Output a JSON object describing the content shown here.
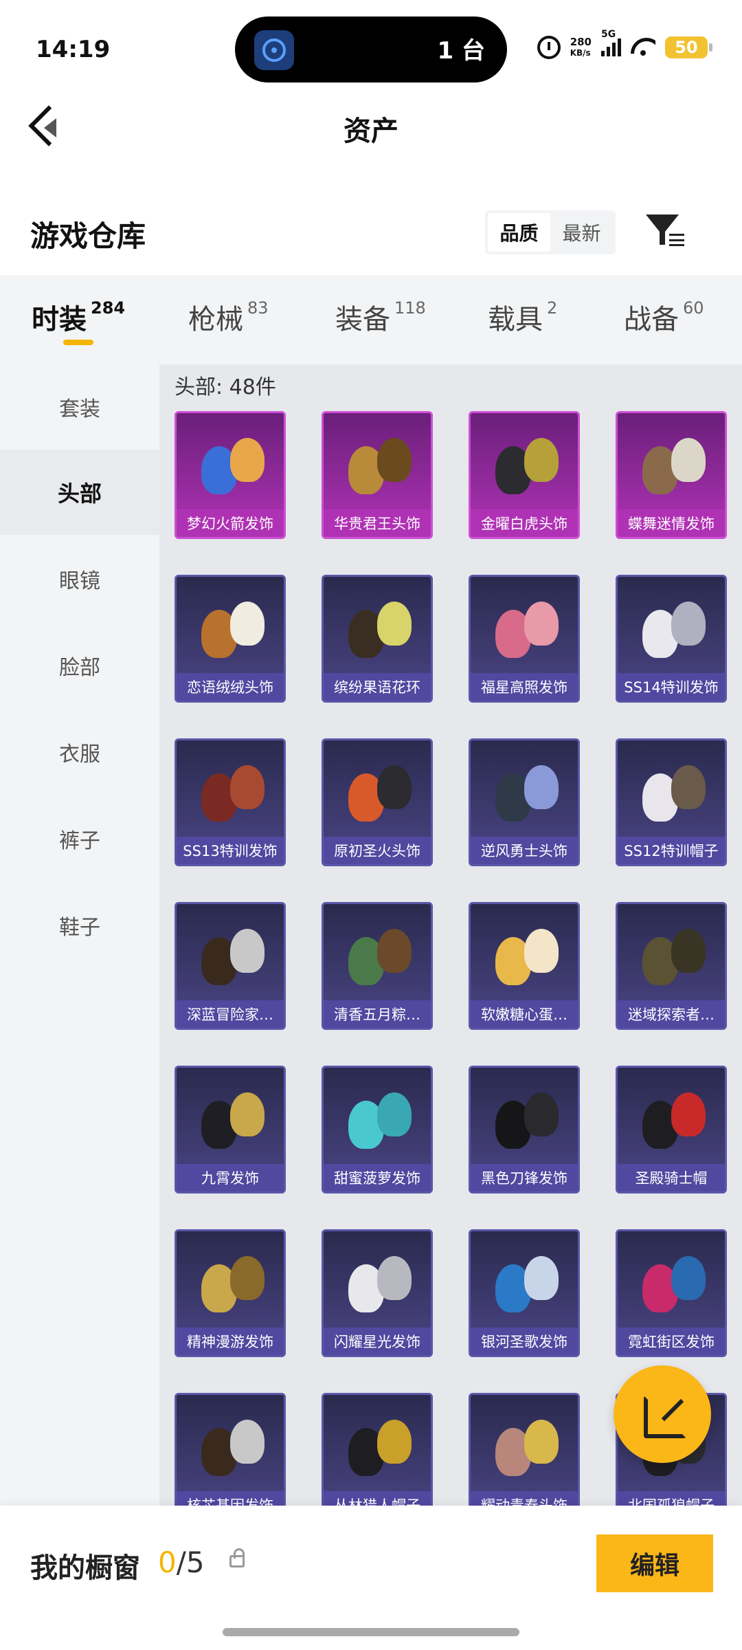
{
  "status_bar": {
    "time": "14:19",
    "island_text": "1 台",
    "island_badge": "1",
    "net_speed_value": "280",
    "net_speed_unit": "KB/s",
    "network": "5G",
    "battery": "50"
  },
  "header": {
    "title": "资产"
  },
  "section": {
    "title": "游戏仓库",
    "sort_options": [
      "品质",
      "最新"
    ],
    "sort_selected": "品质"
  },
  "tabs": [
    {
      "label": "时装",
      "count": "284",
      "active": true
    },
    {
      "label": "枪械",
      "count": "83",
      "active": false
    },
    {
      "label": "装备",
      "count": "118",
      "active": false
    },
    {
      "label": "载具",
      "count": "2",
      "active": false
    },
    {
      "label": "战备",
      "count": "60",
      "active": false
    }
  ],
  "side_nav": [
    {
      "label": "套装",
      "active": false
    },
    {
      "label": "头部",
      "active": true
    },
    {
      "label": "眼镜",
      "active": false
    },
    {
      "label": "脸部",
      "active": false
    },
    {
      "label": "衣服",
      "active": false
    },
    {
      "label": "裤子",
      "active": false
    },
    {
      "label": "鞋子",
      "active": false
    }
  ],
  "grid": {
    "header": "头部: 48件",
    "items": [
      {
        "name": "梦幻火箭发饰",
        "rarity": "purple",
        "colors": [
          "#3a6fd8",
          "#e8a84a"
        ]
      },
      {
        "name": "华贵君王头饰",
        "rarity": "purple",
        "colors": [
          "#b88a3a",
          "#6b4a1f"
        ]
      },
      {
        "name": "金曜白虎头饰",
        "rarity": "purple",
        "colors": [
          "#2b2b30",
          "#b5a03a"
        ]
      },
      {
        "name": "蝶舞迷情发饰",
        "rarity": "purple",
        "colors": [
          "#8a6a4a",
          "#dcd6c8"
        ]
      },
      {
        "name": "恋语绒绒头饰",
        "rarity": "blue",
        "colors": [
          "#b8722e",
          "#f0ece0"
        ]
      },
      {
        "name": "缤纷果语花环",
        "rarity": "blue",
        "colors": [
          "#3a2e22",
          "#d8d36a"
        ]
      },
      {
        "name": "福星高照发饰",
        "rarity": "blue",
        "colors": [
          "#d86a8a",
          "#e89aa8"
        ]
      },
      {
        "name": "SS14特训发饰",
        "rarity": "blue",
        "colors": [
          "#e8e8ee",
          "#b0b0c0"
        ]
      },
      {
        "name": "SS13特训发饰",
        "rarity": "blue",
        "colors": [
          "#7a2a22",
          "#a84a32"
        ]
      },
      {
        "name": "原初圣火头饰",
        "rarity": "blue",
        "colors": [
          "#d85a2a",
          "#2b2b30"
        ]
      },
      {
        "name": "逆风勇士头饰",
        "rarity": "blue",
        "colors": [
          "#2e3a48",
          "#8a9ad8"
        ]
      },
      {
        "name": "SS12特训帽子",
        "rarity": "blue",
        "colors": [
          "#e8e6ec",
          "#6a5a4a"
        ]
      },
      {
        "name": "深蓝冒险家…",
        "rarity": "blue",
        "colors": [
          "#3a2a1e",
          "#c8c8c8"
        ]
      },
      {
        "name": "清香五月粽…",
        "rarity": "blue",
        "colors": [
          "#4a7a4a",
          "#6a4a2a"
        ]
      },
      {
        "name": "软嫩糖心蛋…",
        "rarity": "blue",
        "colors": [
          "#e8b84a",
          "#f4e4c8"
        ]
      },
      {
        "name": "迷域探索者…",
        "rarity": "blue",
        "colors": [
          "#5a5232",
          "#3a3424"
        ]
      },
      {
        "name": "九霄发饰",
        "rarity": "blue",
        "colors": [
          "#1e1e24",
          "#c8a84a"
        ]
      },
      {
        "name": "甜蜜菠萝发饰",
        "rarity": "blue",
        "colors": [
          "#4ac8d0",
          "#3aa8b4"
        ]
      },
      {
        "name": "黑色刀锋发饰",
        "rarity": "blue",
        "colors": [
          "#161618",
          "#2a2a2e"
        ]
      },
      {
        "name": "圣殿骑士帽",
        "rarity": "blue",
        "colors": [
          "#1e1e22",
          "#c82a2a"
        ]
      },
      {
        "name": "精神漫游发饰",
        "rarity": "blue",
        "colors": [
          "#c8a84a",
          "#8a6a2a"
        ]
      },
      {
        "name": "闪耀星光发饰",
        "rarity": "blue",
        "colors": [
          "#e8e8ec",
          "#b8b8c0"
        ]
      },
      {
        "name": "银河圣歌发饰",
        "rarity": "blue",
        "colors": [
          "#2a7ac8",
          "#c8d4e8"
        ]
      },
      {
        "name": "霓虹街区发饰",
        "rarity": "blue",
        "colors": [
          "#c82a6a",
          "#2a6ab0"
        ]
      },
      {
        "name": "核芯基因发饰",
        "rarity": "blue",
        "colors": [
          "#3a2a1e",
          "#c8c8c8"
        ]
      },
      {
        "name": "丛林猎人帽子",
        "rarity": "blue",
        "colors": [
          "#1e1e22",
          "#c8a02a"
        ]
      },
      {
        "name": "耀动青春头饰",
        "rarity": "blue",
        "colors": [
          "#b8867a",
          "#d8b84a"
        ]
      },
      {
        "name": "北国孤狼帽子",
        "rarity": "blue",
        "colors": [
          "#1e1e22",
          "#2a2a2e"
        ]
      }
    ]
  },
  "showcase": {
    "label": "我的橱窗",
    "current": "0",
    "separator": "/",
    "max": "5",
    "edit_label": "编辑"
  },
  "colors": {
    "accent": "#fbb618",
    "purple_rarity": "#b032b4",
    "blue_rarity": "#5148a0"
  }
}
